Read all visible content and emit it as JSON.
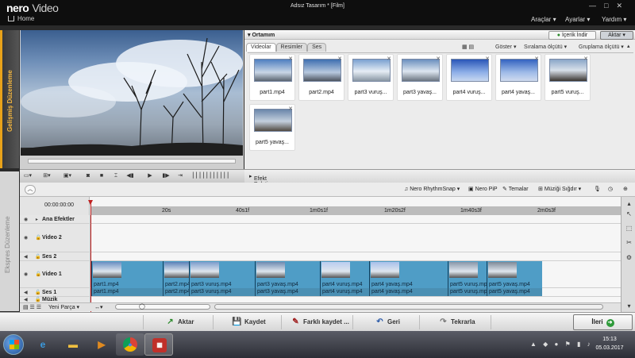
{
  "app": {
    "logo": "nero",
    "product": "Video",
    "document_title": "Adsız Tasarım * [Film]",
    "home_label": "Home",
    "window_controls": [
      "—",
      "□",
      "✕"
    ]
  },
  "top_menu": [
    "Araçlar",
    "Ayarlar",
    "Yardım"
  ],
  "side_tabs": {
    "advanced": "Gelişmiş Düzenleme",
    "express": "Ekspres Düzenleme"
  },
  "library": {
    "title": "Ortamım",
    "content_button": "İçerik İndir",
    "export_button": "Aktar",
    "tabs": [
      "Videolar",
      "Resimler",
      "Ses"
    ],
    "active_tab": "Videolar",
    "options": [
      "Göster",
      "Sıralama ölçütü",
      "Gruplama ölçütü"
    ],
    "items": [
      {
        "name": "part1.mp4"
      },
      {
        "name": "part2.mp4"
      },
      {
        "name": "part3 vuruş..."
      },
      {
        "name": "part3 yavaş..."
      },
      {
        "name": "part4 vuruş..."
      },
      {
        "name": "part4 yavaş..."
      },
      {
        "name": "part5 vuruş..."
      },
      {
        "name": "part5 yavaş..."
      }
    ]
  },
  "effects_palette": "Efekt Paleti:",
  "timeline_toolbar": {
    "rhythmsnap": "Nero RhythmSnap",
    "pip": "Nero PiP",
    "themes": "Temalar",
    "fit_music": "Müziği Sığdır"
  },
  "timeline": {
    "timecode": "00:00:00:00",
    "ruler_ticks": [
      "20s",
      "40s1f",
      "1m0s1f",
      "1m20s2f",
      "1m40s3f",
      "2m0s3f"
    ],
    "tracks": {
      "main_effects": "Ana Efektler",
      "video2": "Video 2",
      "audio2": "Ses 2",
      "video1": "Video 1",
      "audio1": "Ses 1",
      "music": "Müzik"
    },
    "video1_clips": [
      {
        "label": "part1.mp4"
      },
      {
        "label": "part2.mp4"
      },
      {
        "label": "part3 vuruş.mp4"
      },
      {
        "label": "part3 yavaş.mp4"
      },
      {
        "label": "part4 vuruş.mp4"
      },
      {
        "label": "part4 yavaş.mp4"
      },
      {
        "label": "part5 vuruş.mp4"
      },
      {
        "label": "part5 yavaş.mp4"
      }
    ],
    "audio1_clips": [
      {
        "label": "part1.mp4"
      },
      {
        "label": "part2.mp4"
      },
      {
        "label": "part3 vuruş.mp4"
      },
      {
        "label": "part3 yavaş.mp4"
      },
      {
        "label": "part4 vuruş.mp4"
      },
      {
        "label": "part4 yavaş.mp4"
      },
      {
        "label": "part5 vuruş.mp4"
      },
      {
        "label": "part5 yavaş.mp4"
      }
    ],
    "new_part": "Yeni Parça"
  },
  "actions": {
    "export": "Aktar",
    "save": "Kaydet",
    "save_as": "Farklı kaydet ...",
    "back": "Geri",
    "repeat": "Tekrarla",
    "next": "İleri"
  },
  "taskbar": {
    "time": "15:13",
    "date": "05.03.2017"
  },
  "colors": {
    "accent": "#e8a21a",
    "clip_video": "#4f9dc6",
    "clip_audio": "#4a8fb3",
    "playhead": "#c02020"
  }
}
